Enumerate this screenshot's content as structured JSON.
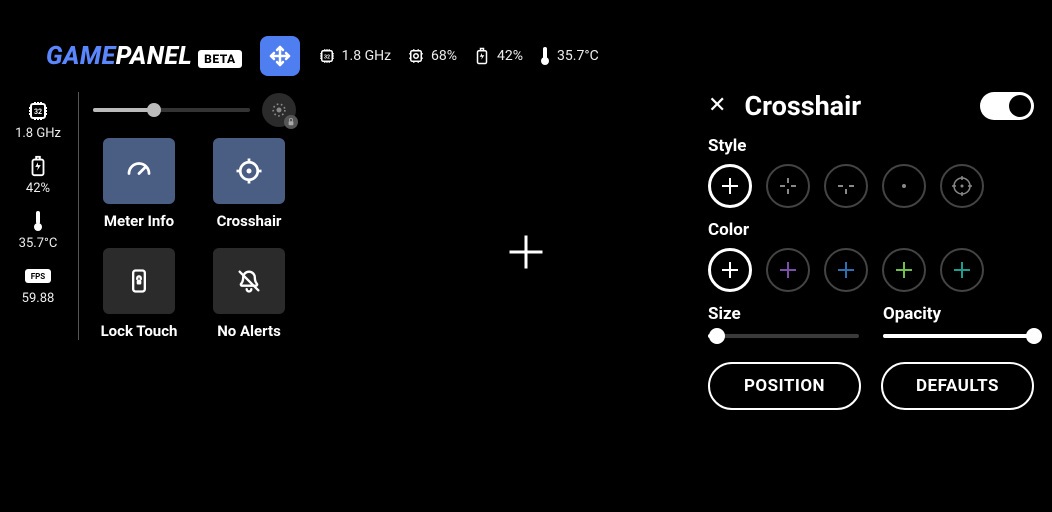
{
  "app": {
    "name_part1": "GAME",
    "name_part2": "PANEL",
    "beta_badge": "BETA"
  },
  "status": {
    "cpu_freq": "1.8 GHz",
    "mem_pct": "68%",
    "bat_pct": "42%",
    "temp": "35.7°C"
  },
  "meters": {
    "cpu_freq": "1.8 GHz",
    "bat_pct": "42%",
    "temp": "35.7°C",
    "fps": "59.88"
  },
  "brightness": {
    "value": 38,
    "auto_locked": true
  },
  "tiles": [
    {
      "id": "meter-info",
      "label": "Meter Info",
      "active": true
    },
    {
      "id": "crosshair",
      "label": "Crosshair",
      "active": true
    },
    {
      "id": "lock-touch",
      "label": "Lock Touch",
      "active": false
    },
    {
      "id": "no-alerts",
      "label": "No Alerts",
      "active": false
    }
  ],
  "crosshair_panel": {
    "title": "Crosshair",
    "enabled": true,
    "style_label": "Style",
    "color_label": "Color",
    "size_label": "Size",
    "opacity_label": "Opacity",
    "position_btn": "POSITION",
    "defaults_btn": "DEFAULTS",
    "styles": [
      "plus",
      "plus-dashed",
      "t-shape",
      "dot",
      "reticle"
    ],
    "style_selected": 0,
    "colors": [
      "#ffffff",
      "#9b59d6",
      "#3498db",
      "#7ed957",
      "#1abc9c"
    ],
    "color_selected": 0,
    "size": 6,
    "opacity": 100
  }
}
